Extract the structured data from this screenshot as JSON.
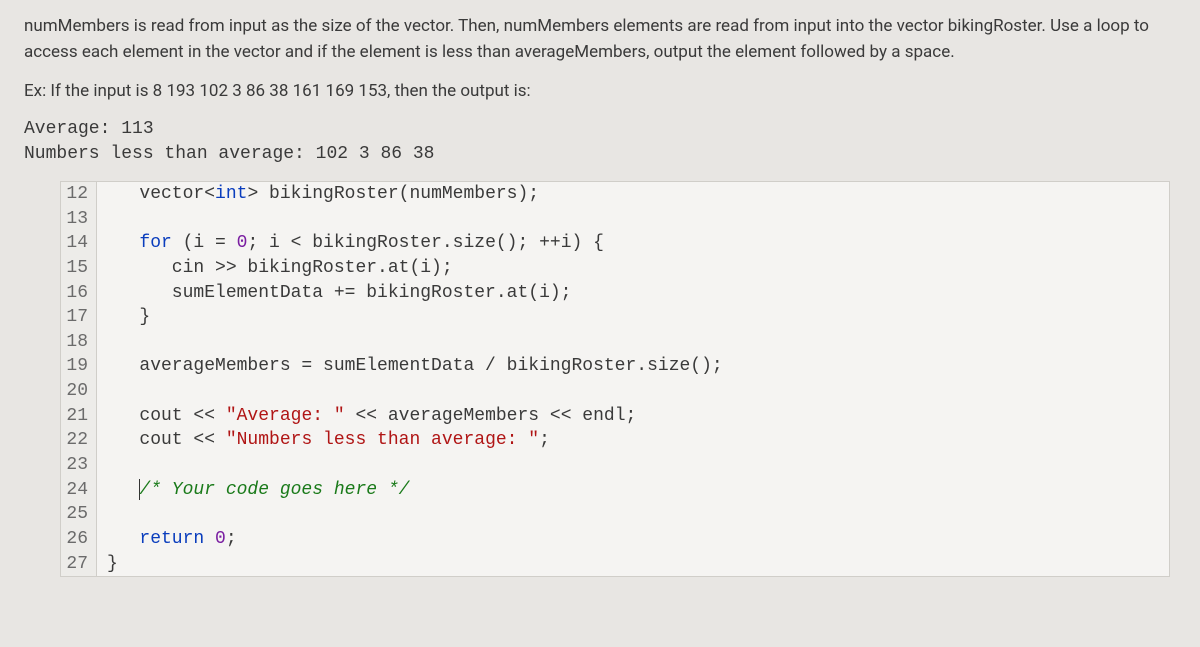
{
  "prompt": {
    "p1": "numMembers is read from input as the size of the vector. Then, numMembers elements are read from input into the vector bikingRoster. Use a loop to access each element in the vector and if the element is less than averageMembers, output the element followed by a space.",
    "ex_label": "Ex: If the input is 8 193 102 3 86 38 161 169 153, then the output is:"
  },
  "output": {
    "line1": "Average: 113",
    "line2": "Numbers less than average: 102 3 86 38"
  },
  "code": {
    "lines": [
      {
        "n": "12",
        "segs": [
          {
            "t": "   vector<"
          },
          {
            "t": "int",
            "c": "type"
          },
          {
            "t": "> bikingRoster(numMembers);"
          }
        ]
      },
      {
        "n": "13",
        "segs": [
          {
            "t": ""
          }
        ]
      },
      {
        "n": "14",
        "segs": [
          {
            "t": "   "
          },
          {
            "t": "for",
            "c": "kw"
          },
          {
            "t": " (i = "
          },
          {
            "t": "0",
            "c": "num"
          },
          {
            "t": "; i < bikingRoster.size(); ++i) {"
          }
        ]
      },
      {
        "n": "15",
        "segs": [
          {
            "t": "      cin >> bikingRoster.at(i);"
          }
        ]
      },
      {
        "n": "16",
        "segs": [
          {
            "t": "      sumElementData += bikingRoster.at(i);"
          }
        ]
      },
      {
        "n": "17",
        "segs": [
          {
            "t": "   }"
          }
        ]
      },
      {
        "n": "18",
        "segs": [
          {
            "t": ""
          }
        ]
      },
      {
        "n": "19",
        "segs": [
          {
            "t": "   averageMembers = sumElementData / bikingRoster.size();"
          }
        ]
      },
      {
        "n": "20",
        "segs": [
          {
            "t": ""
          }
        ]
      },
      {
        "n": "21",
        "segs": [
          {
            "t": "   cout << "
          },
          {
            "t": "\"Average: \"",
            "c": "str"
          },
          {
            "t": " << averageMembers << endl;"
          }
        ]
      },
      {
        "n": "22",
        "segs": [
          {
            "t": "   cout << "
          },
          {
            "t": "\"Numbers less than average: \"",
            "c": "str"
          },
          {
            "t": ";"
          }
        ]
      },
      {
        "n": "23",
        "segs": [
          {
            "t": ""
          }
        ]
      },
      {
        "n": "24",
        "segs": [
          {
            "t": "   "
          },
          {
            "t": "CURSOR",
            "cursor": true
          },
          {
            "t": "/* Your code goes here */",
            "c": "comment"
          }
        ]
      },
      {
        "n": "25",
        "segs": [
          {
            "t": ""
          }
        ]
      },
      {
        "n": "26",
        "segs": [
          {
            "t": "   "
          },
          {
            "t": "return",
            "c": "kw"
          },
          {
            "t": " "
          },
          {
            "t": "0",
            "c": "num"
          },
          {
            "t": ";"
          }
        ]
      },
      {
        "n": "27",
        "segs": [
          {
            "t": "}"
          }
        ]
      }
    ]
  }
}
